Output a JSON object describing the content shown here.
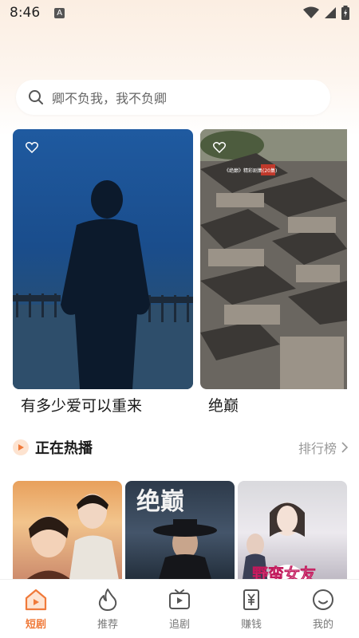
{
  "status_bar": {
    "time": "8:46",
    "notification_letter": "A"
  },
  "search": {
    "placeholder": "卿不负我，我不负卿"
  },
  "featured": [
    {
      "title": "有多少爱可以重来"
    },
    {
      "title": "绝巅",
      "overlay_caption": "《绝巅》精彩剧集(20集)"
    }
  ],
  "hot_section": {
    "title": "正在热播",
    "more_label": "排行榜"
  },
  "hot_thumbs": [
    {
      "overlay_text": ""
    },
    {
      "overlay_text": "绝巅"
    },
    {
      "overlay_text": "野蛮女友"
    }
  ],
  "tabbar": {
    "items": [
      {
        "label": "短剧",
        "icon": "home-icon",
        "active": true
      },
      {
        "label": "推荐",
        "icon": "flame-icon",
        "active": false
      },
      {
        "label": "追剧",
        "icon": "tv-play-icon",
        "active": false
      },
      {
        "label": "赚钱",
        "icon": "yen-scroll-icon",
        "active": false
      },
      {
        "label": "我的",
        "icon": "smile-face-icon",
        "active": false
      }
    ]
  },
  "colors": {
    "accent": "#f07a3a",
    "text_muted": "#999999"
  }
}
